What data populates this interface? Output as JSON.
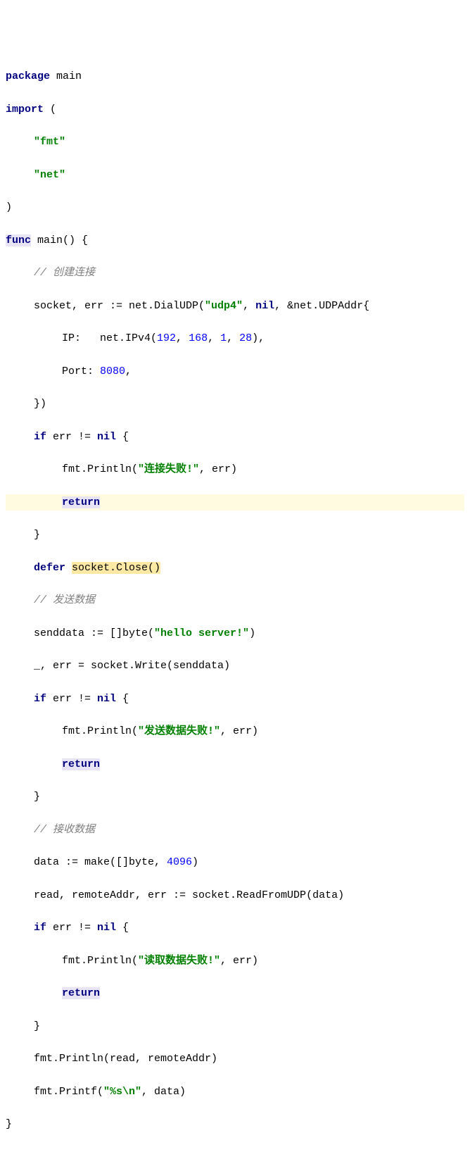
{
  "code": {
    "l1": {
      "kw1": "package",
      "id": " main"
    },
    "l2": {
      "kw1": "import",
      "p": " ("
    },
    "l3": {
      "s": "\"fmt\""
    },
    "l4": {
      "s": "\"net\""
    },
    "l5": {
      "p": ")"
    },
    "l6": {
      "kw1": "func",
      "id1": " main",
      "p": "() {"
    },
    "l7": {
      "c": "// 创建连接"
    },
    "l8": {
      "id1": "socket, err := net.DialUDP(",
      "s1": "\"udp4\"",
      "id2": ", ",
      "kw1": "nil",
      "id3": ", &net.UDPAddr{"
    },
    "l9": {
      "id1": "IP:   net.IPv4(",
      "n1": "192",
      "c1": ", ",
      "n2": "168",
      "c2": ", ",
      "n3": "1",
      "c3": ", ",
      "n4": "28",
      "id2": "),"
    },
    "l10": {
      "id1": "Port: ",
      "n1": "8080",
      "id2": ","
    },
    "l11": {
      "p": "})"
    },
    "l12": {
      "kw1": "if",
      "id1": " err != ",
      "kw2": "nil",
      "p": " {"
    },
    "l13": {
      "id1": "fmt.Println(",
      "s1": "\"连接失败!\"",
      "id2": ", err)"
    },
    "l14": {
      "kw1": "return"
    },
    "l15": {
      "p": "}"
    },
    "l16": {
      "kw1": "defer",
      " sp": " ",
      "id1": "socket.Close()"
    },
    "l17": {
      "c": "// 发送数据"
    },
    "l18": {
      "id1": "senddata := []byte(",
      "s1": "\"hello server!\"",
      "id2": ")"
    },
    "l19": {
      "id": "_, err = socket.Write(senddata)"
    },
    "l20": {
      "kw1": "if",
      "id1": " err != ",
      "kw2": "nil",
      "p": " {"
    },
    "l21": {
      "id1": "fmt.Println(",
      "s1": "\"发送数据失败!\"",
      "id2": ", err)"
    },
    "l22": {
      "kw1": "return"
    },
    "l23": {
      "p": "}"
    },
    "l24": {
      "c": "// 接收数据"
    },
    "l25": {
      "id1": "data := make([]byte, ",
      "n1": "4096",
      "id2": ")"
    },
    "l26": {
      "id": "read, remoteAddr, err := socket.ReadFromUDP(data)"
    },
    "l27": {
      "kw1": "if",
      "id1": " err != ",
      "kw2": "nil",
      "p": " {"
    },
    "l28": {
      "id1": "fmt.Println(",
      "s1": "\"读取数据失败!\"",
      "id2": ", err)"
    },
    "l29": {
      "kw1": "return"
    },
    "l30": {
      "p": "}"
    },
    "l31": {
      "id": "fmt.Println(read, remoteAddr)"
    },
    "l32": {
      "id1": "fmt.Printf(",
      "s1": "\"%s\\n\"",
      "id2": ", data)"
    },
    "l33": {
      "p": "}"
    }
  }
}
